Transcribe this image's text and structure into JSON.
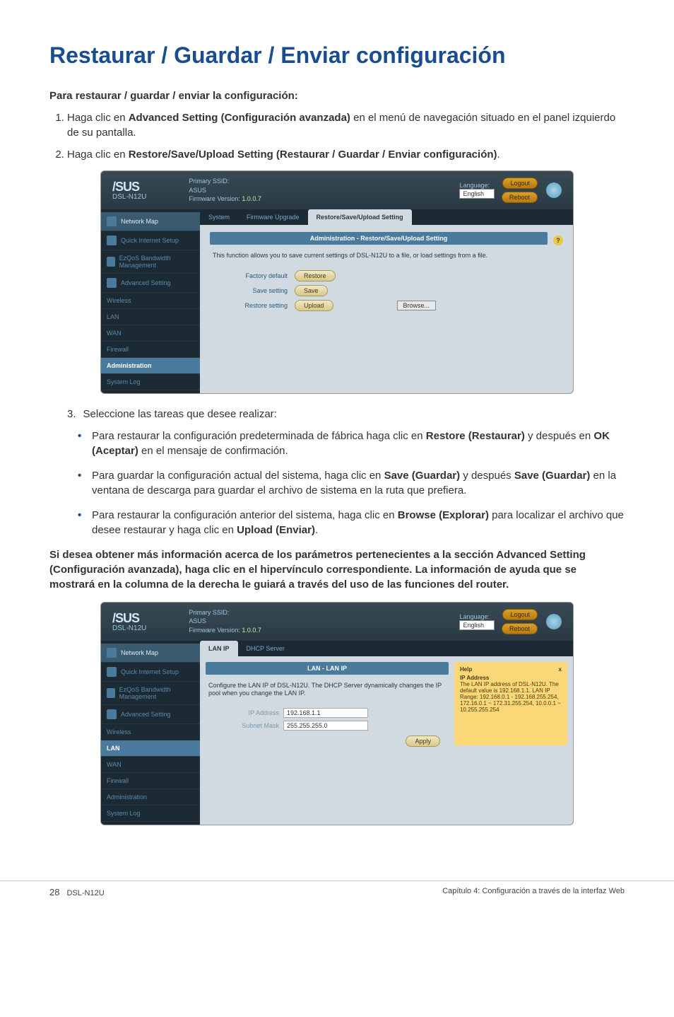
{
  "page": {
    "title": "Restaurar / Guardar / Enviar configuración",
    "subtitle": "Para restaurar / guardar / enviar la configuración:",
    "step1_pre": "Haga clic en ",
    "step1_bold": "Advanced Setting (Configuración avanzada)",
    "step1_post": " en el menú de navegación situado en el panel izquierdo de su pantalla.",
    "step2_pre": "Haga clic en ",
    "step2_bold": "Restore/Save/Upload Setting (Restaurar / Guardar / Enviar configuración)",
    "step2_post": ".",
    "step3": "Seleccione las tareas que desee realizar:",
    "b1_pre": "Para restaurar la configuración predeterminada de fábrica haga clic en ",
    "b1_bold1": "Restore (Restaurar)",
    "b1_mid": " y después en ",
    "b1_bold2": "OK (Aceptar)",
    "b1_post": " en el mensaje de confirmación.",
    "b2_pre": "Para guardar la configuración actual del sistema, haga clic en ",
    "b2_bold1": "Save (Guardar)",
    "b2_mid": " y después ",
    "b2_bold2": "Save (Guardar)",
    "b2_post": " en la ventana de descarga para guardar el archivo de sistema en la ruta que prefiera.",
    "b3_pre": "Para restaurar la configuración anterior del sistema, haga clic en ",
    "b3_bold1": "Browse (Explorar)",
    "b3_mid": " para localizar el archivo que desee restaurar y haga clic en ",
    "b3_bold2": "Upload (Enviar)",
    "b3_post": ".",
    "bold_para": "Si desea obtener más información acerca de los parámetros pertenecientes a la sección Advanced Setting (Configuración avanzada), haga clic en el hipervínculo correspondiente. La información de ayuda que se mostrará en la columna de la derecha le guiará a través del uso de las funciones del router."
  },
  "router": {
    "brand": "/SUS",
    "model": "DSL-N12U",
    "ssid_label": "Primary SSID:",
    "ssid_value": "ASUS",
    "fw_label": "Firmware Version:",
    "fw_value": "1.0.0.7",
    "lang_label": "Language:",
    "lang_value": "English",
    "logout_btn": "Logout",
    "reboot_btn": "Reboot",
    "sidebar": {
      "network_map": "Network Map",
      "quick_setup": "Quick Internet Setup",
      "ezqos": "EzQoS Bandwidth Management",
      "adv_setting": "Advanced Setting",
      "wireless": "Wireless",
      "lan": "LAN",
      "wan": "WAN",
      "firewall": "Firewall",
      "administration": "Administration",
      "system_log": "System Log"
    },
    "tabs1": {
      "system": "System",
      "firmware": "Firmware Upgrade",
      "restore": "Restore/Save/Upload Setting"
    },
    "panel1": {
      "title": "Administration - Restore/Save/Upload Setting",
      "desc": "This function allows you to save current settings of DSL-N12U to a file, or load settings from a file.",
      "factory_label": "Factory default",
      "restore_btn": "Restore",
      "save_label": "Save setting",
      "save_btn": "Save",
      "restore_label": "Restore setting",
      "upload_btn": "Upload",
      "browse_btn": "Browse..."
    },
    "tabs2": {
      "lan_ip": "LAN IP",
      "dhcp": "DHCP Server"
    },
    "panel2": {
      "title": "LAN - LAN IP",
      "desc": "Configure the LAN IP of DSL-N12U. The DHCP Server dynamically changes the IP pool when you change the LAN IP.",
      "ip_label": "IP Address",
      "ip_value": "192.168.1.1",
      "subnet_label": "Subnet Mask",
      "subnet_value": "255.255.255.0",
      "apply_btn": "Apply"
    },
    "help": {
      "title": "Help",
      "close": "x",
      "heading": "IP Address",
      "body": "The LAN IP address of DSL-N12U. The default value is 192.168.1.1. LAN IP Range: 192.168.0.1 - 192.168.255.254, 172.16.0.1 ~ 172.31.255.254, 10.0.0.1 ~ 10.255.255.254"
    }
  },
  "footer": {
    "page_num": "28",
    "model": "DSL-N12U",
    "chapter": "Capítulo 4: Configuración a través de la interfaz Web"
  }
}
